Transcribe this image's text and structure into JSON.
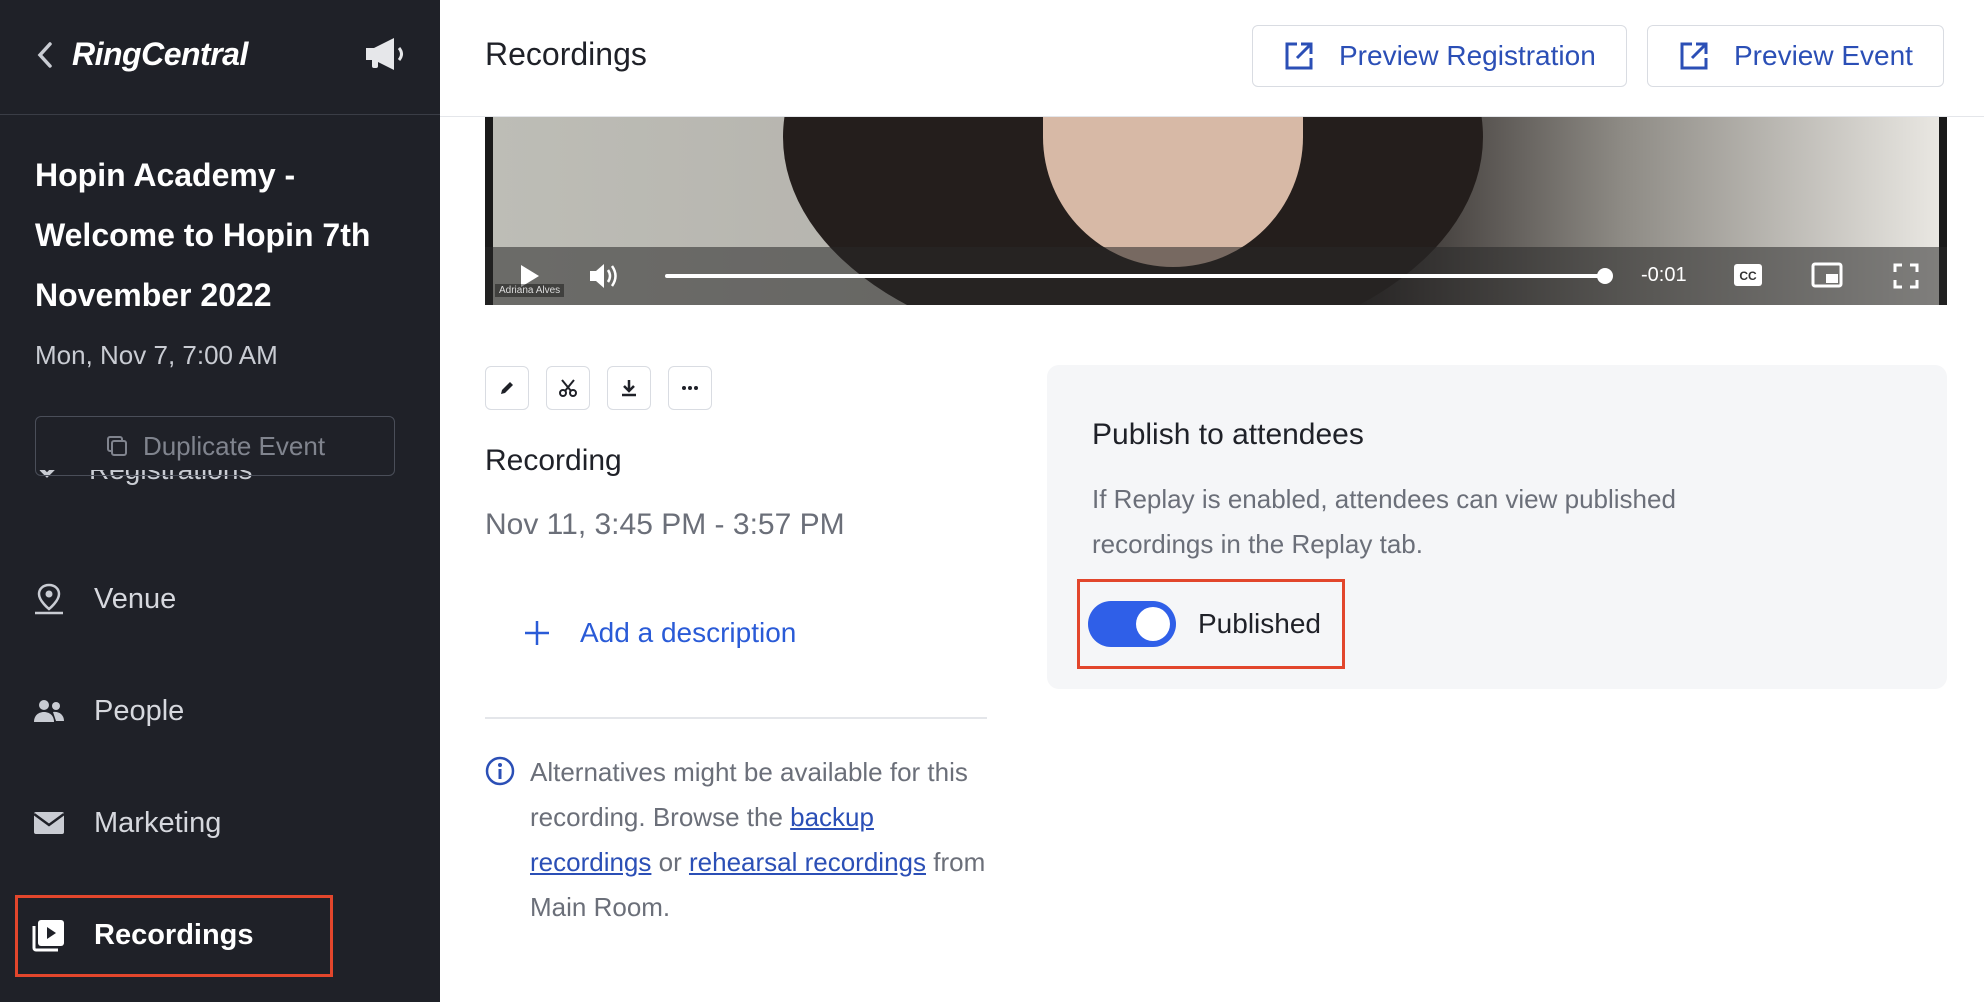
{
  "app": {
    "brand": "RingCentral"
  },
  "sidebar": {
    "event_title": "Hopin Academy - Welcome to Hopin 7th November 2022",
    "event_date": "Mon, Nov 7, 7:00 AM",
    "duplicate_label": "Duplicate Event",
    "clipped_item_label": "Registrations",
    "items": [
      {
        "label": "Venue",
        "icon": "venue-pin-icon"
      },
      {
        "label": "People",
        "icon": "people-icon"
      },
      {
        "label": "Marketing",
        "icon": "mail-icon"
      },
      {
        "label": "Recordings",
        "icon": "recordings-icon",
        "active": true
      }
    ]
  },
  "header": {
    "title": "Recordings",
    "preview_registration": "Preview Registration",
    "preview_event": "Preview Event"
  },
  "player": {
    "time_remaining": "-0:01",
    "progress_fraction": 0.99,
    "caption_tag": "Adriana Alves"
  },
  "recording": {
    "title": "Recording",
    "time_range": "Nov 11, 3:45 PM - 3:57 PM",
    "add_description": "Add a description",
    "alt_text_1": "Alternatives might be available for this recording. Browse the ",
    "backup_link": "backup recordings",
    "alt_text_2": " or ",
    "rehearsal_link": "rehearsal recordings",
    "alt_text_3": " from Main Room."
  },
  "publish": {
    "title": "Publish to attendees",
    "description": "If Replay is enabled, attendees can view published recordings in the Replay tab.",
    "toggle_label": "Published",
    "toggle_on": true
  },
  "colors": {
    "sidebar_bg": "#1f2128",
    "accent": "#2f5fe8",
    "highlight": "#e2462c",
    "link": "#2b4fb6"
  }
}
